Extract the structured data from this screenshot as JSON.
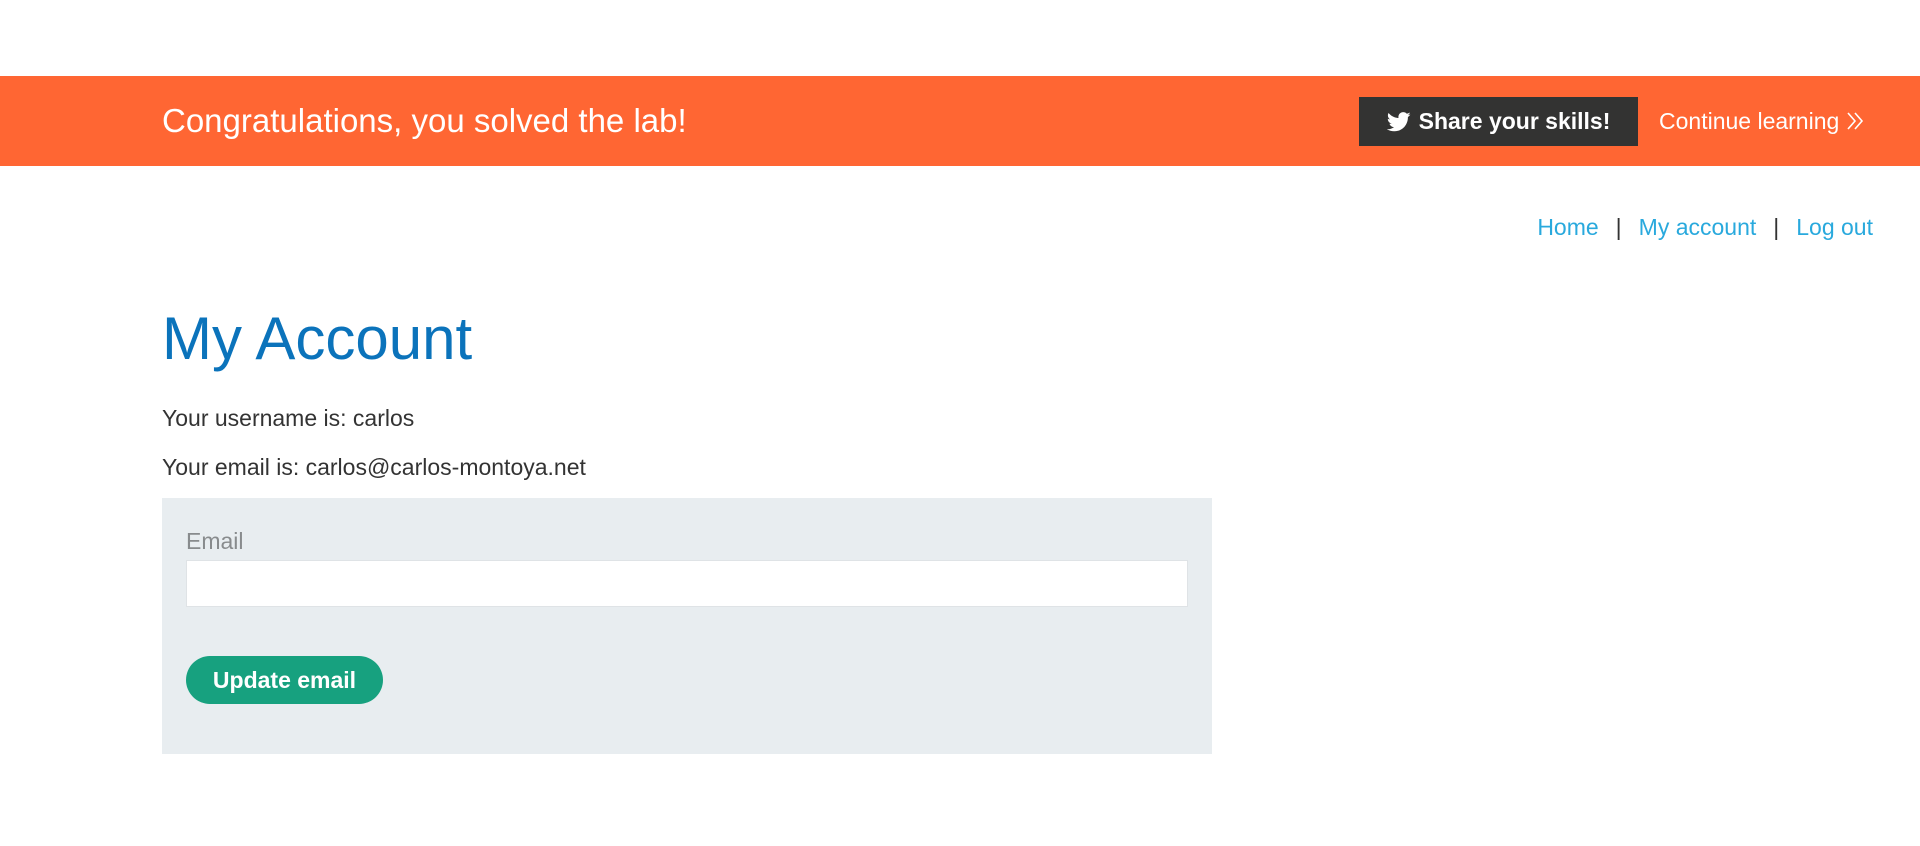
{
  "banner": {
    "message": "Congratulations, you solved the lab!",
    "share_label": "Share your skills!",
    "share_icon": "twitter-icon",
    "continue_label": "Continue learning",
    "continue_icon": "double-chevron-right-icon",
    "background_color": "#ff6633"
  },
  "nav": {
    "home": "Home",
    "separator": "|",
    "my_account": "My account",
    "log_out": "Log out",
    "link_color": "#29a9dd"
  },
  "page": {
    "title": "My Account",
    "title_color": "#0b73bb",
    "username_line": "Your username is: carlos",
    "email_line": "Your email is: carlos@carlos-montoya.net"
  },
  "form": {
    "email_label": "Email",
    "email_value": "",
    "submit_label": "Update email",
    "submit_color": "#17a17f"
  }
}
